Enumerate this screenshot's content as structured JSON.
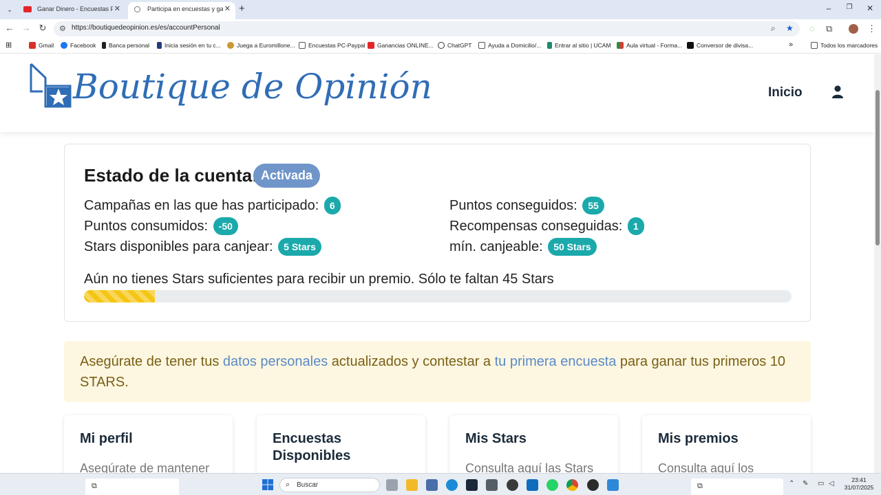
{
  "browser": {
    "tabs": [
      {
        "title": "Ganar Dinero - Encuestas Pagad"
      },
      {
        "title": "Participa en encuestas y gana p"
      }
    ],
    "url": "https://boutiquedeopinion.es/es/accountPersonal",
    "bookmarks": [
      "Gmail",
      "Facebook",
      "Banca personal",
      "Inicia sesión en tu c...",
      "Juega a Euromillone...",
      "Encuestas PC-Paypal",
      "Ganancias ONLINE...",
      "ChatGPT",
      "Ayuda a Domicilio/...",
      "Entrar al sitio | UCAM",
      "Aula virtual - Forma...",
      "Conversor de divisa..."
    ],
    "all_bookmarks": "Todos los marcadores"
  },
  "site": {
    "logo_text": "Boutique de Opinión",
    "nav_home": "Inicio"
  },
  "account": {
    "title": "Estado de la cuenta:",
    "status": "Activada",
    "campaigns_label": "Campañas en las que has participado:",
    "campaigns_value": "6",
    "points_earned_label": "Puntos conseguidos:",
    "points_earned_value": "55",
    "points_used_label": "Puntos consumidos:",
    "points_used_value": "-50",
    "rewards_label": "Recompensas conseguidas:",
    "rewards_value": "1",
    "stars_available_label": "Stars disponibles para canjear:",
    "stars_available_value": "5 Stars",
    "min_redeem_label": "mín. canjeable:",
    "min_redeem_value": "50 Stars",
    "progress_message": "Aún no tienes Stars suficientes para recibir un premio. Sólo te faltan 45 Stars",
    "progress_fraction": 0.1
  },
  "alert": {
    "part1": "Asegúrate de tener tus ",
    "link1": "datos personales",
    "part2": " actualizados y contestar a ",
    "link2": "tu primera encuesta",
    "part3": " para ganar tus primeros 10 STARS."
  },
  "cards": [
    {
      "title": "Mi perfil",
      "desc": "Asegúrate de mantener"
    },
    {
      "title": "Encuestas Disponibles",
      "desc": ""
    },
    {
      "title": "Mis Stars",
      "desc": "Consulta aquí las Stars"
    },
    {
      "title": "Mis premios",
      "desc": "Consulta aquí los"
    }
  ],
  "taskbar": {
    "search_label": "Buscar",
    "time": "23:41",
    "date": "31/07/2025"
  },
  "colors": {
    "brand_blue": "#2f6db6",
    "status_badge": "#6f95c9",
    "pill_teal": "#1ba9ab",
    "progress_yellow": "#f5c516",
    "alert_bg": "#fdf7e2"
  }
}
